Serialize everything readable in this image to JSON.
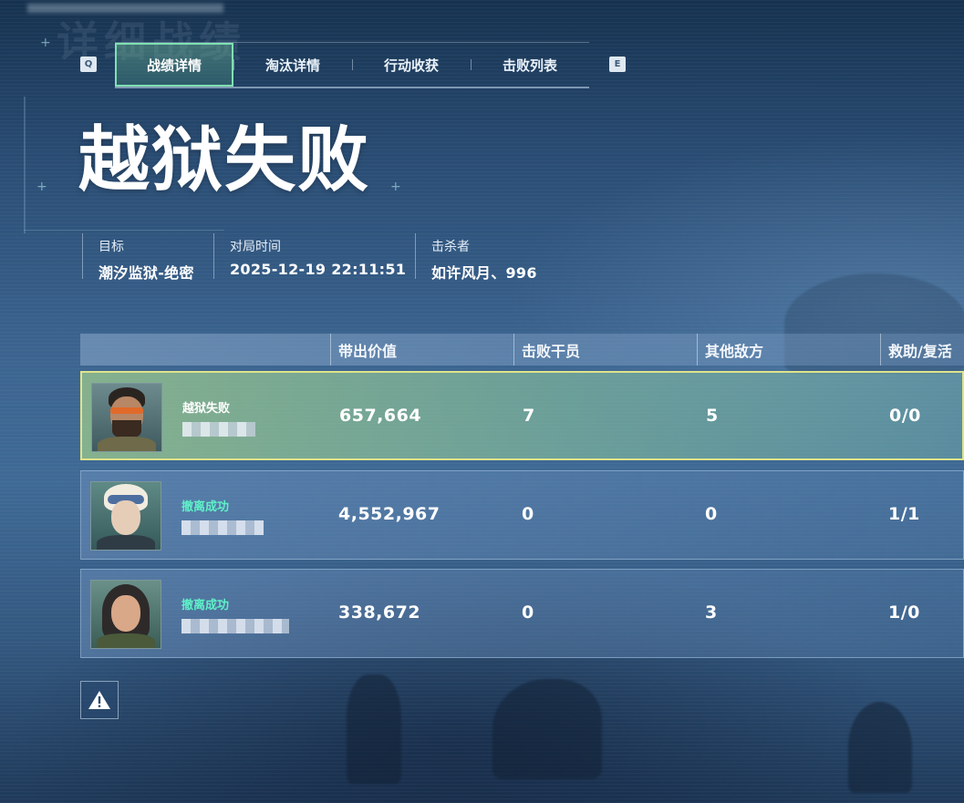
{
  "screen": {
    "bg_title": "详细战绩",
    "result_title": "越狱失败"
  },
  "tabs": {
    "prev_key": "Q",
    "next_key": "E",
    "items": [
      {
        "label": "战绩详情",
        "active": true
      },
      {
        "label": "淘汰详情",
        "active": false
      },
      {
        "label": "行动收获",
        "active": false
      },
      {
        "label": "击败列表",
        "active": false
      }
    ]
  },
  "info": {
    "target_label": "目标",
    "target_value": "潮汐监狱-绝密",
    "time_label": "对局时间",
    "time_value": "2025-12-19 22:11:51",
    "killer_label": "击杀者",
    "killer_value": "如许风月、996"
  },
  "table": {
    "columns": [
      "带出价值",
      "击败干员",
      "其他敌方",
      "救助/复活"
    ],
    "rows": [
      {
        "status": "越狱失败",
        "status_color": "#ffffff",
        "value": "657,664",
        "kills": "7",
        "others": "5",
        "assist": "0/0",
        "highlight": true,
        "avatar": "bearded-operator-with-goggles"
      },
      {
        "status": "撤离成功",
        "status_color": "#5ff0c8",
        "value": "4,552,967",
        "kills": "0",
        "others": "0",
        "assist": "1/1",
        "highlight": false,
        "avatar": "operator-with-white-helmet"
      },
      {
        "status": "撤离成功",
        "status_color": "#5ff0c8",
        "value": "338,672",
        "kills": "0",
        "others": "3",
        "assist": "1/0",
        "highlight": false,
        "avatar": "operator-with-long-dark-hair"
      }
    ]
  },
  "warning_button": {
    "icon": "warning-icon"
  }
}
